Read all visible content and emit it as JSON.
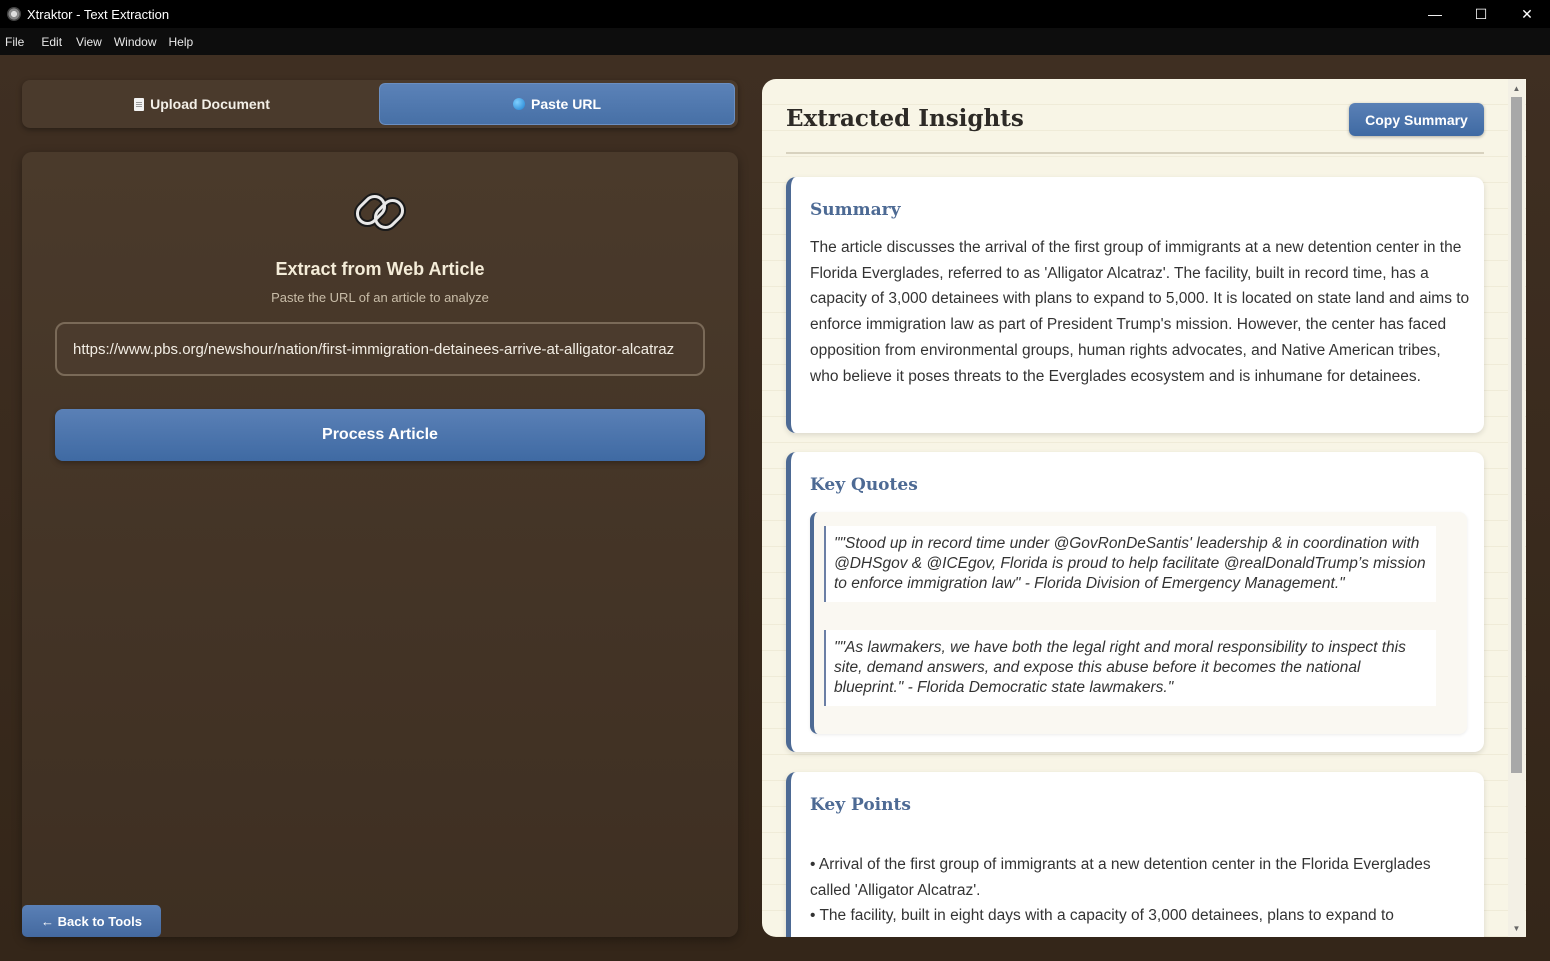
{
  "window": {
    "title": "Xtraktor - Text Extraction",
    "minimize_icon": "minimize-icon",
    "maximize_icon": "maximize-icon",
    "close_icon": "close-icon"
  },
  "menu": [
    "File",
    "Edit",
    "View",
    "Window",
    "Help"
  ],
  "tabs": {
    "upload_label": "Upload Document",
    "paste_label": "Paste URL",
    "active": "paste"
  },
  "input_panel": {
    "title": "Extract from Web Article",
    "subtitle": "Paste the URL of an article to analyze",
    "url_value": "https://www.pbs.org/newshour/nation/first-immigration-detainees-arrive-at-alligator-alcatraz",
    "process_label": "Process Article",
    "back_label": "← Back to Tools"
  },
  "results": {
    "title": "Extracted Insights",
    "copy_label": "Copy Summary",
    "summary": {
      "heading": "Summary",
      "text": "The article discusses the arrival of the first group of immigrants at a new detention center in the Florida Everglades, referred to as 'Alligator Alcatraz'. The facility, built in record time, has a capacity of 3,000 detainees with plans to expand to 5,000. It is located on state land and aims to enforce immigration law as part of President Trump's mission. However, the center has faced opposition from environmental groups, human rights advocates, and Native American tribes, who believe it poses threats to the Everglades ecosystem and is inhumane for detainees."
    },
    "quotes": {
      "heading": "Key Quotes",
      "items": [
        "\"\"Stood up in record time under @GovRonDeSantis' leadership & in coordination with @DHSgov & @ICEgov, Florida is proud to help facilitate @realDonaldTrump’s mission to enforce immigration law\" - Florida Division of Emergency Management.\"",
        "\"\"As lawmakers, we have both the legal right and moral responsibility to inspect this site, demand answers, and expose this abuse before it becomes the national blueprint.\" - Florida Democratic state lawmakers.\""
      ]
    },
    "points": {
      "heading": "Key Points",
      "items": [
        "• Arrival of the first group of immigrants at a new detention center in the Florida Everglades called 'Alligator Alcatraz'.",
        "• The facility, built in eight days with a capacity of 3,000 detainees, plans to expand to"
      ]
    }
  },
  "colors": {
    "accent": "#4d6a94",
    "button": "#4770a6",
    "background": "#3a2b20",
    "results_bg": "#f8f5e6"
  }
}
